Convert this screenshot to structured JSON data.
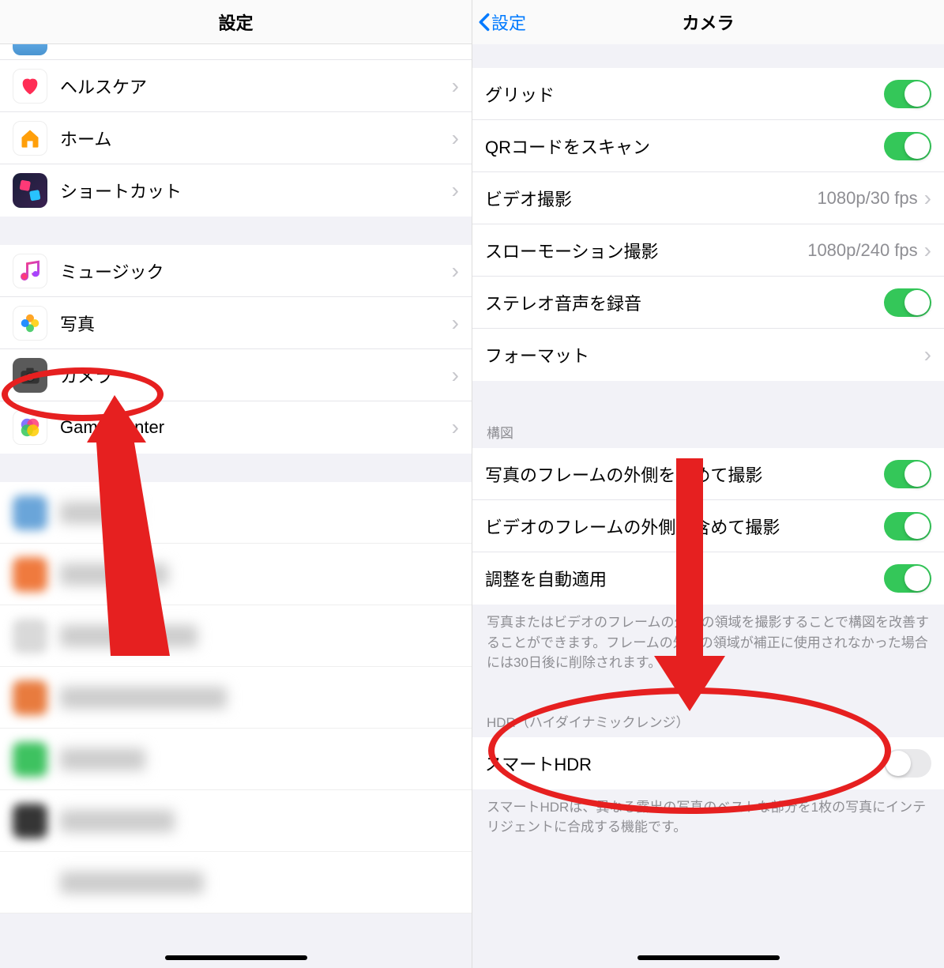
{
  "left": {
    "title": "設定",
    "group1": [
      {
        "label": "ヘルスケア",
        "icon_bg": "#fff",
        "icon_border": "#eee",
        "glyph": "heart",
        "glyph_color": "#ff2d55"
      },
      {
        "label": "ホーム",
        "icon_bg": "#fff",
        "icon_border": "#eee",
        "glyph": "home",
        "glyph_color": "#ff9500"
      },
      {
        "label": "ショートカット",
        "icon_bg": "linear-gradient(135deg,#1a1f3a,#3a2050)",
        "icon_border": "transparent",
        "glyph": "shortcuts",
        "glyph_color": ""
      }
    ],
    "group2": [
      {
        "label": "ミュージック",
        "icon_bg": "#fff",
        "icon_border": "#eee",
        "glyph": "music",
        "glyph_color": ""
      },
      {
        "label": "写真",
        "icon_bg": "#fff",
        "icon_border": "#eee",
        "glyph": "photos",
        "glyph_color": ""
      },
      {
        "label": "カメラ",
        "icon_bg": "#5a5a5a",
        "icon_border": "transparent",
        "glyph": "camera",
        "glyph_color": "#333"
      },
      {
        "label": "Game Center",
        "icon_bg": "#fff",
        "icon_border": "#eee",
        "glyph": "gamecenter",
        "glyph_color": ""
      }
    ],
    "blurred_icons": [
      "#6aa5d9",
      "#ef7a3e",
      "#d9d9d9",
      "#e87b3e",
      "#3ec260",
      "#353535",
      "#ffffff"
    ]
  },
  "right": {
    "back_label": "設定",
    "title": "カメラ",
    "rows1": [
      {
        "label": "グリッド",
        "type": "toggle",
        "on": true
      },
      {
        "label": "QRコードをスキャン",
        "type": "toggle",
        "on": true
      },
      {
        "label": "ビデオ撮影",
        "type": "value",
        "value": "1080p/30 fps"
      },
      {
        "label": "スローモーション撮影",
        "type": "value",
        "value": "1080p/240 fps"
      },
      {
        "label": "ステレオ音声を録音",
        "type": "toggle",
        "on": true
      },
      {
        "label": "フォーマット",
        "type": "nav"
      }
    ],
    "composition_header": "構図",
    "rows2": [
      {
        "label": "写真のフレームの外側を含めて撮影",
        "type": "toggle",
        "on": true
      },
      {
        "label": "ビデオのフレームの外側を含めて撮影",
        "type": "toggle",
        "on": true
      },
      {
        "label": "調整を自動適用",
        "type": "toggle",
        "on": true
      }
    ],
    "composition_footer": "写真またはビデオのフレームの外側の領域を撮影することで構図を改善することができます。フレームの外側の領域が補正に使用されなかった場合には30日後に削除されます。",
    "hdr_header": "HDR（ハイダイナミックレンジ）",
    "rows3": [
      {
        "label": "スマートHDR",
        "type": "toggle",
        "on": false
      }
    ],
    "hdr_footer": "スマートHDRは、異なる露出の写真のベストな部分を1枚の写真にインテリジェントに合成する機能です。"
  }
}
